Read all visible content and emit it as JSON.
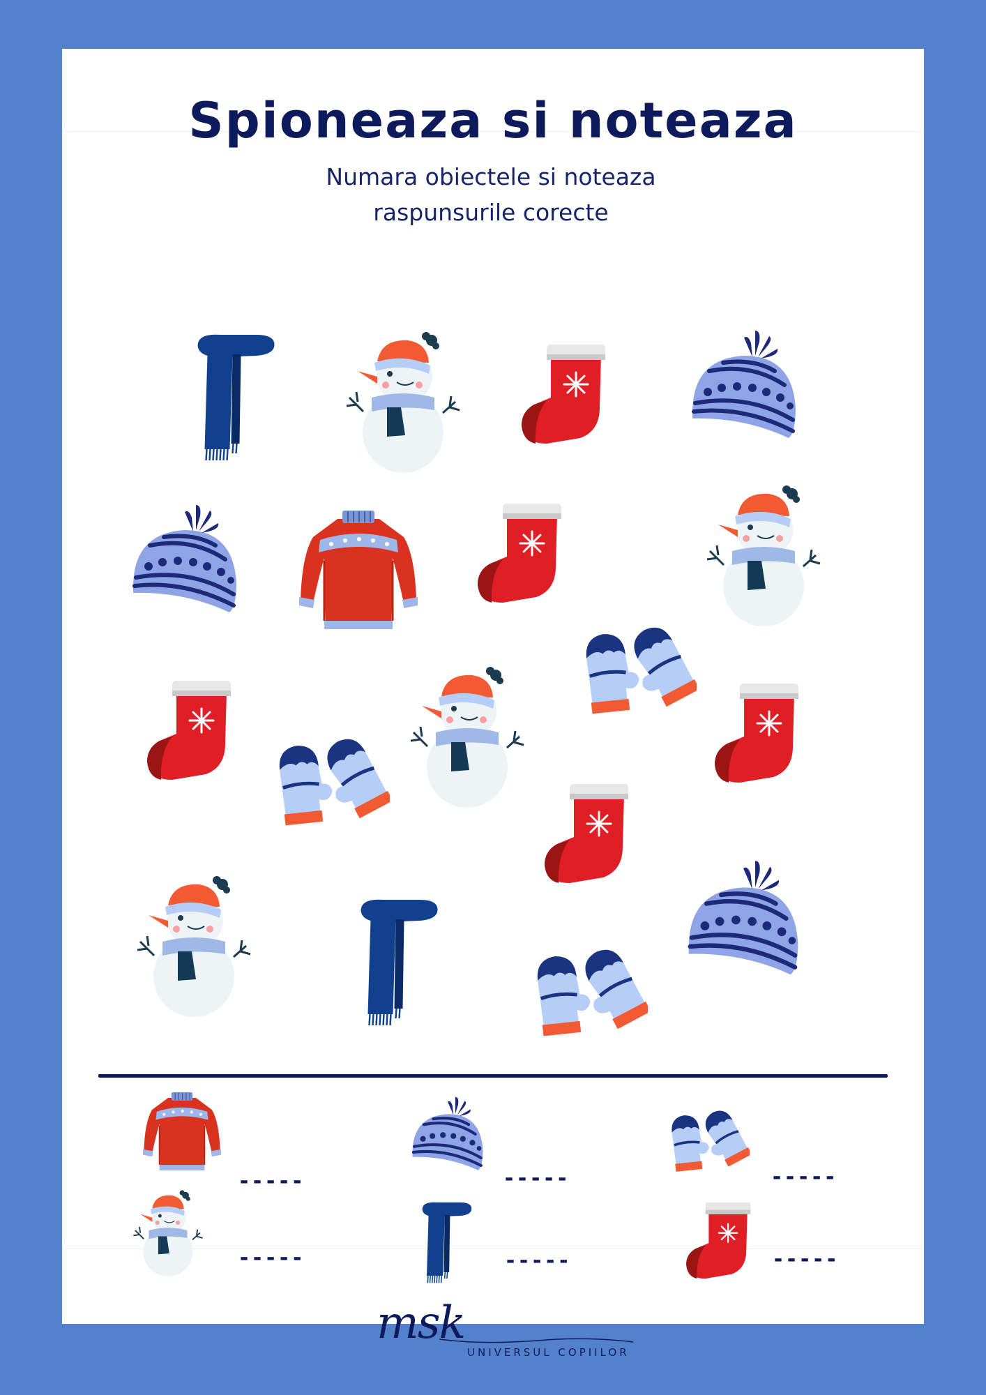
{
  "title": "Spioneaza si noteaza",
  "subtitle": "Numara obiectele si noteaza raspunsurile corecte",
  "answer_blank": "-----",
  "logo": {
    "script": "msk",
    "subtitle": "UNIVERSUL COPIILOR"
  },
  "colors": {
    "frame": "#5481cb",
    "text": "#0d1b5c",
    "scarf": "#0f3b8c",
    "sock_red": "#e01e26",
    "hat_blue": "#8fa4e6",
    "mitten_light": "#b6cdf8",
    "accent_orange": "#f25a34",
    "snow": "#eef3f6"
  },
  "icons": {
    "scarf": "scarf-icon",
    "snowman": "snowman-icon",
    "sock": "christmas-stocking-icon",
    "hat": "winter-hat-icon",
    "sweater": "sweater-icon",
    "mittens": "mittens-icon"
  }
}
